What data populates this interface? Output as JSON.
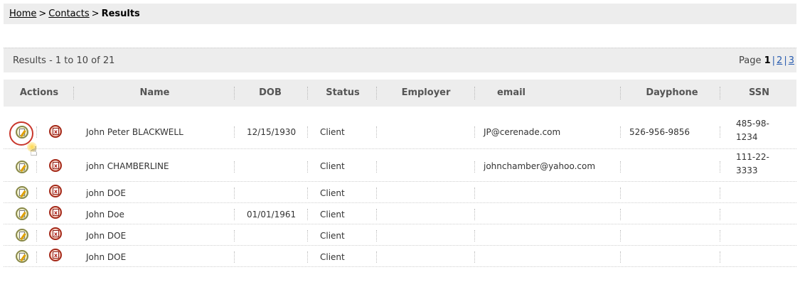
{
  "breadcrumb": {
    "home": "Home",
    "contacts": "Contacts",
    "current": "Results",
    "separator": ">"
  },
  "results_bar": {
    "summary": "Results - 1 to 10 of 21",
    "page_label": "Page",
    "pages": [
      "1",
      "2",
      "3"
    ],
    "current_page": "1"
  },
  "table": {
    "headers": [
      "Actions",
      "Name",
      "DOB",
      "Status",
      "Employer",
      "email",
      "Dayphone",
      "SSN"
    ],
    "rows": [
      {
        "name": "John  Peter BLACKWELL",
        "dob": "12/15/1930",
        "status": "Client",
        "employer": "",
        "email": "JP@cerenade.com",
        "dayphone": "526-956-9856",
        "ssn_line1": "485-98-",
        "ssn_line2": "1234"
      },
      {
        "name": "john  CHAMBERLINE",
        "dob": "",
        "status": "Client",
        "employer": "",
        "email": "johnchamber@yahoo.com",
        "dayphone": "",
        "ssn_line1": "111-22-",
        "ssn_line2": "3333"
      },
      {
        "name": "john  DOE",
        "dob": "",
        "status": "Client",
        "employer": "",
        "email": "",
        "dayphone": "",
        "ssn_line1": "",
        "ssn_line2": ""
      },
      {
        "name": "John  Doe",
        "dob": "01/01/1961",
        "status": "Client",
        "employer": "",
        "email": "",
        "dayphone": "",
        "ssn_line1": "",
        "ssn_line2": ""
      },
      {
        "name": "John  DOE",
        "dob": "",
        "status": "Client",
        "employer": "",
        "email": "",
        "dayphone": "",
        "ssn_line1": "",
        "ssn_line2": ""
      },
      {
        "name": "John  DOE",
        "dob": "",
        "status": "Client",
        "employer": "",
        "email": "",
        "dayphone": "",
        "ssn_line1": "",
        "ssn_line2": ""
      }
    ]
  },
  "icons": {
    "edit": "edit-icon",
    "delete": "delete-icon",
    "cursor": "pointer-cursor-icon"
  },
  "colors": {
    "bar_bg": "#ededed",
    "link": "#2a5db0",
    "highlight": "#c9372c"
  }
}
